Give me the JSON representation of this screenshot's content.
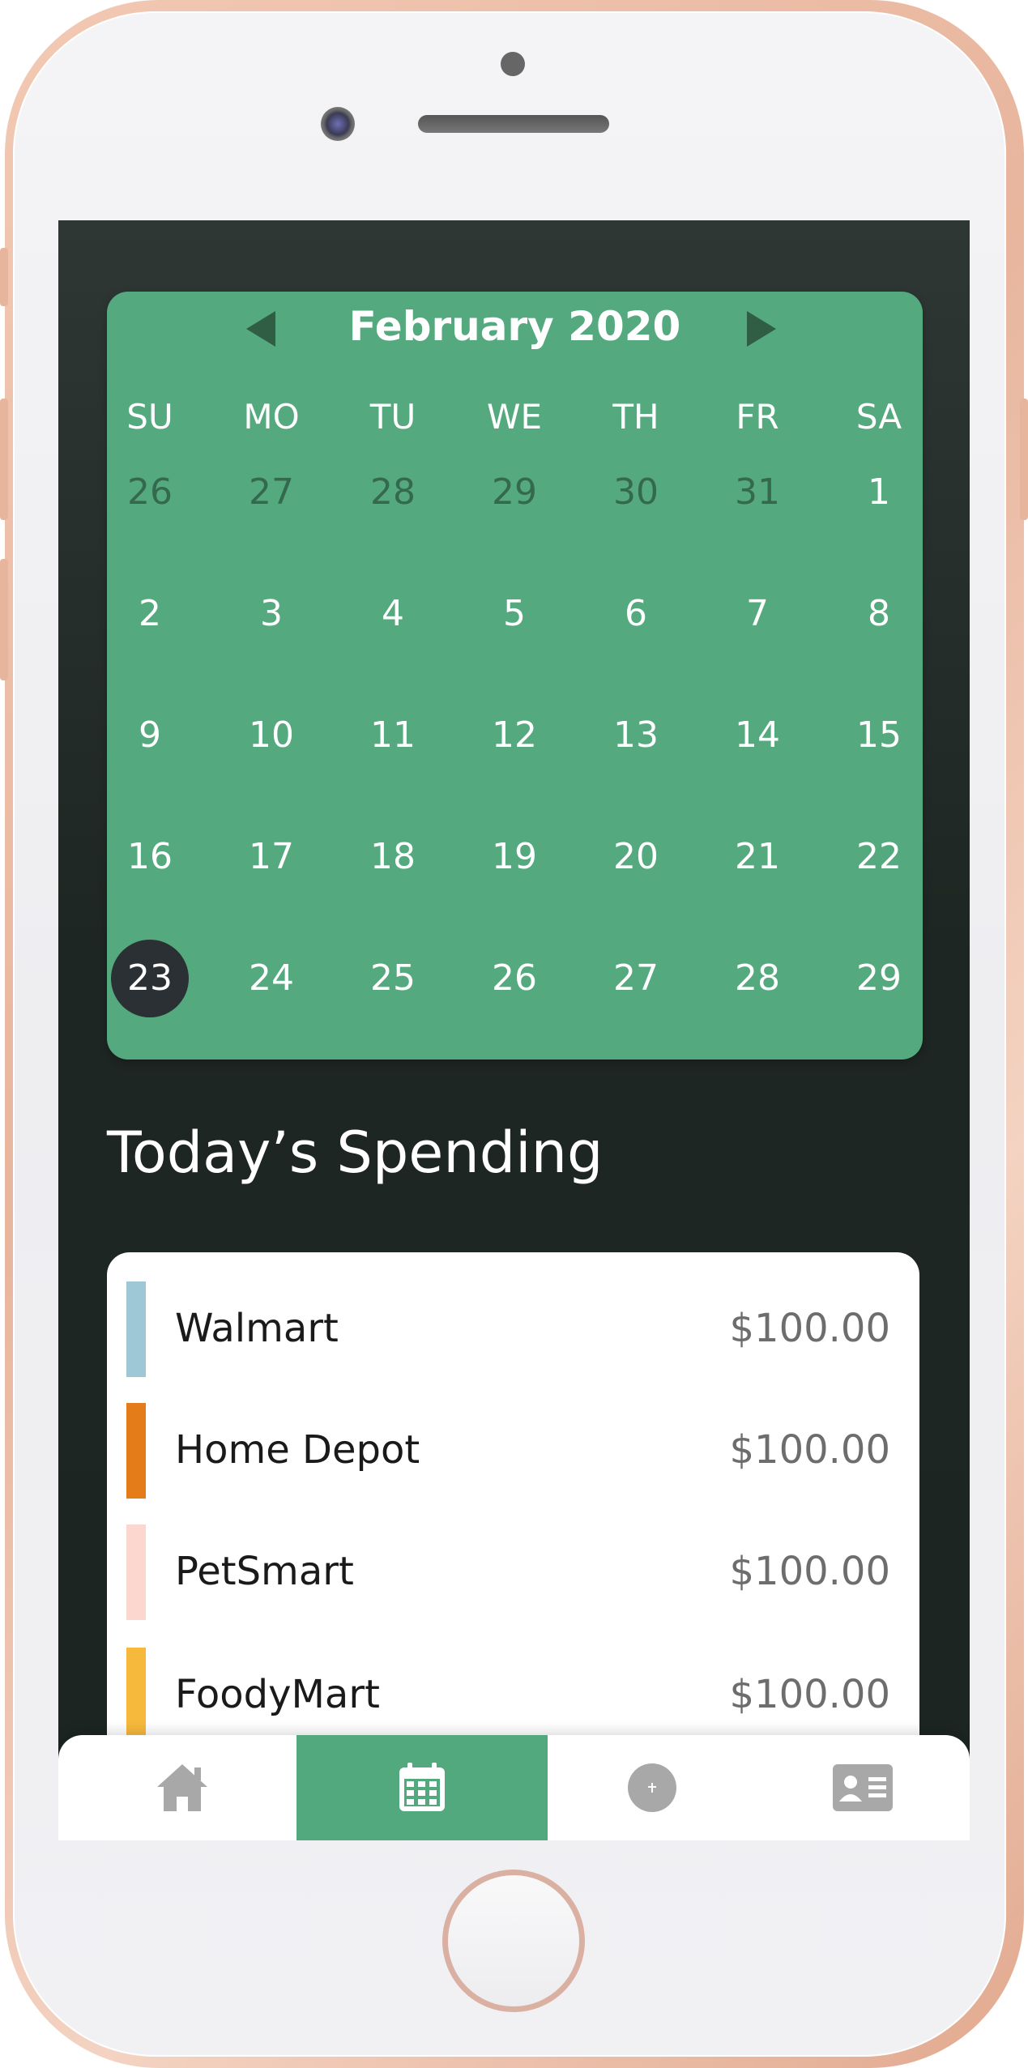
{
  "calendar": {
    "month_label": "February 2020",
    "days_of_week": [
      "SU",
      "MO",
      "TU",
      "WE",
      "TH",
      "FR",
      "SA"
    ],
    "weeks": [
      [
        "26",
        "27",
        "28",
        "29",
        "30",
        "31",
        "1"
      ],
      [
        "2",
        "3",
        "4",
        "5",
        "6",
        "7",
        "8"
      ],
      [
        "9",
        "10",
        "11",
        "12",
        "13",
        "14",
        "15"
      ],
      [
        "16",
        "17",
        "18",
        "19",
        "20",
        "21",
        "22"
      ],
      [
        "23",
        "24",
        "25",
        "26",
        "27",
        "28",
        "29"
      ]
    ],
    "previous_month_days_visible": 6,
    "selected_day": "23"
  },
  "spending": {
    "title": "Today’s Spending",
    "items": [
      {
        "name": "Walmart",
        "amount": "$100.00",
        "color": "#9ec8d6"
      },
      {
        "name": "Home Depot",
        "amount": "$100.00",
        "color": "#e57c1a"
      },
      {
        "name": "PetSmart",
        "amount": "$100.00",
        "color": "#fbd7cf"
      },
      {
        "name": "FoodyMart",
        "amount": "$100.00",
        "color": "#f7b93c"
      }
    ]
  },
  "nav": {
    "items": [
      {
        "name": "home",
        "icon": "home-icon",
        "active": false
      },
      {
        "name": "calendar",
        "icon": "calendar-icon",
        "active": true
      },
      {
        "name": "add",
        "icon": "plus-circle-icon",
        "active": false
      },
      {
        "name": "profile",
        "icon": "id-card-icon",
        "active": false
      }
    ]
  },
  "colors": {
    "accent": "#54aa7e",
    "background": "#1e2623",
    "selected_day": "#2a3033"
  }
}
